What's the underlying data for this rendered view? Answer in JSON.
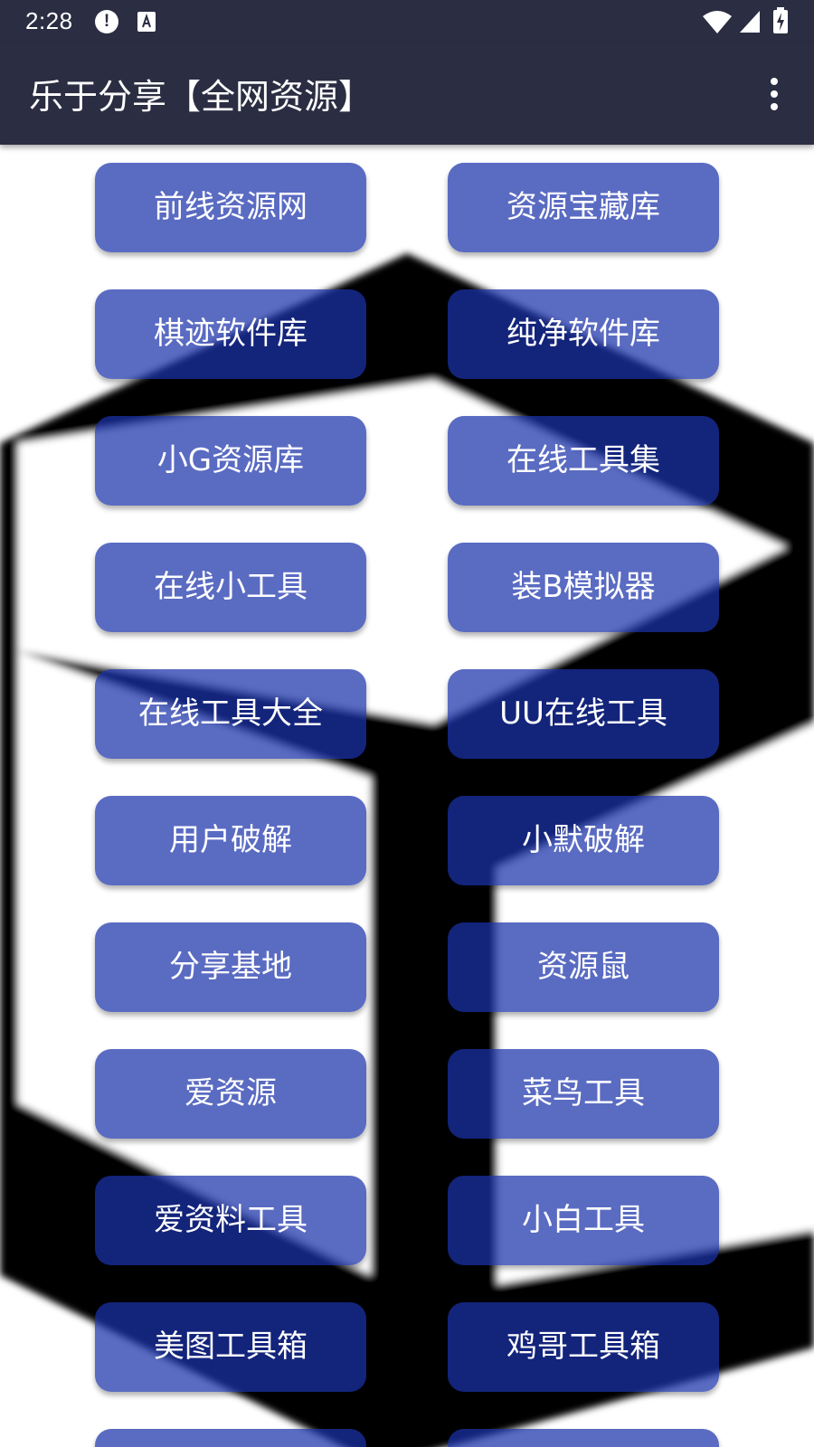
{
  "status_bar": {
    "time": "2:28",
    "icons": [
      "alert-icon",
      "accessibility-text-icon",
      "wifi-icon",
      "signal-icon",
      "battery-charging-icon"
    ]
  },
  "app_bar": {
    "title": "乐于分享【全网资源】",
    "menu_icon": "more-vert-icon"
  },
  "buttons": [
    {
      "left": "前线资源网",
      "right": "资源宝藏库"
    },
    {
      "left": "棋迹软件库",
      "right": "纯净软件库"
    },
    {
      "left": "小G资源库",
      "right": "在线工具集"
    },
    {
      "left": "在线小工具",
      "right": "装B模拟器"
    },
    {
      "left": "在线工具大全",
      "right": "UU在线工具"
    },
    {
      "left": "用户破解",
      "right": "小默破解"
    },
    {
      "left": "分享基地",
      "right": "资源鼠"
    },
    {
      "left": "爱资源",
      "right": "菜鸟工具"
    },
    {
      "left": "爱资料工具",
      "right": "小白工具"
    },
    {
      "left": "美图工具箱",
      "right": "鸡哥工具箱"
    },
    {
      "left": "",
      "right": ""
    }
  ],
  "colors": {
    "app_bar": "#2b2d42",
    "button": "#1a32aa",
    "text": "#ffffff"
  }
}
